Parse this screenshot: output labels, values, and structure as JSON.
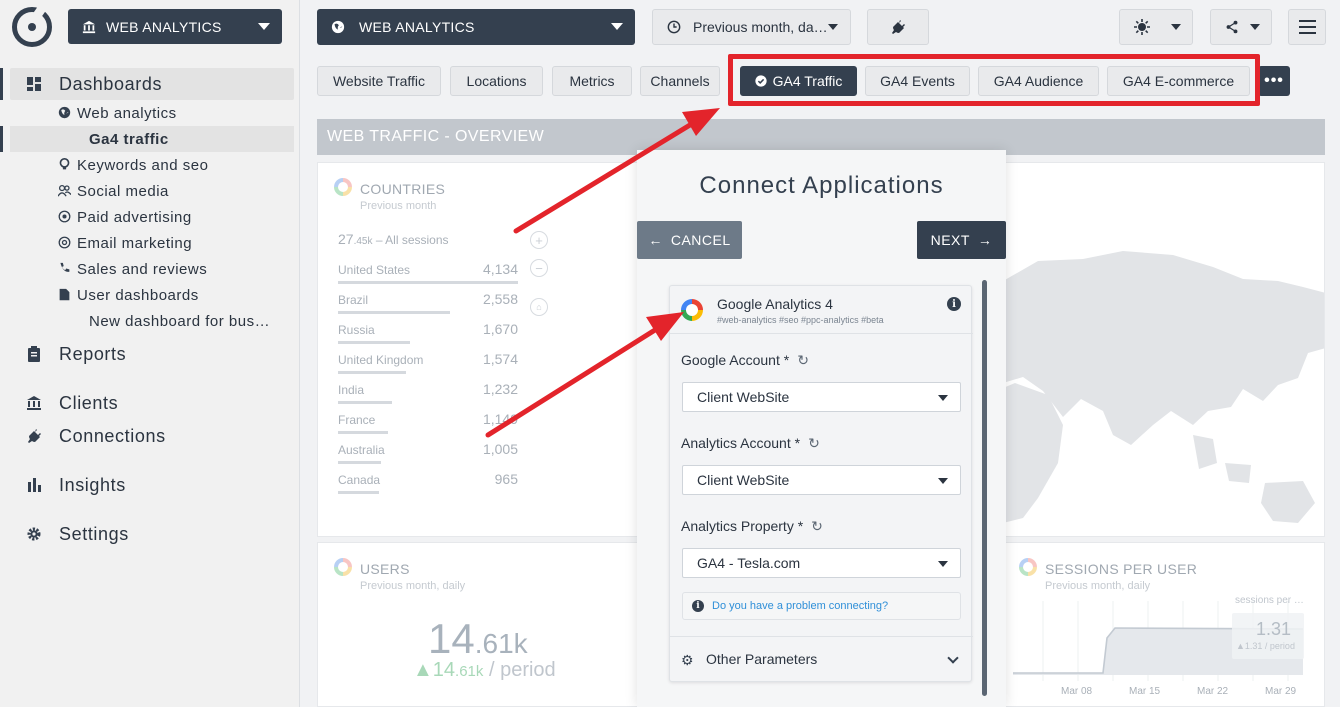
{
  "sidebar": {
    "workspace": "WEB ANALYTICS",
    "nav": {
      "dashboards": "Dashboards",
      "web_analytics": "Web analytics",
      "ga4_traffic": "Ga4 traffic",
      "keywords": "Keywords and seo",
      "social": "Social media",
      "paid": "Paid advertising",
      "email": "Email marketing",
      "sales": "Sales and reviews",
      "user_dashboards": "User dashboards",
      "new_dashboard": "New dashboard for bus…",
      "reports": "Reports",
      "clients": "Clients",
      "connections": "Connections",
      "insights": "Insights",
      "settings": "Settings"
    }
  },
  "topbar": {
    "project": "WEB ANALYTICS",
    "date_range": "Previous month, da…"
  },
  "tabs": [
    "Website Traffic",
    "Locations",
    "Metrics",
    "Channels",
    "GA4 Traffic",
    "GA4 Events",
    "GA4 Audience",
    "GA4 E-commerce"
  ],
  "tab_more": "•••",
  "dashboard": {
    "section_title": "WEB TRAFFIC - OVERVIEW",
    "countries": {
      "title": "COUNTRIES",
      "subtitle": "Previous month",
      "total_num": "27",
      "total_small": ".45k",
      "total_label": " – All sessions",
      "rows": [
        {
          "name": "United States",
          "value": "4,134",
          "share": 1.0
        },
        {
          "name": "Brazil",
          "value": "2,558",
          "share": 0.62
        },
        {
          "name": "Russia",
          "value": "1,670",
          "share": 0.4
        },
        {
          "name": "United Kingdom",
          "value": "1,574",
          "share": 0.38
        },
        {
          "name": "India",
          "value": "1,232",
          "share": 0.3
        },
        {
          "name": "France",
          "value": "1,149",
          "share": 0.28
        },
        {
          "name": "Australia",
          "value": "1,005",
          "share": 0.24
        },
        {
          "name": "Canada",
          "value": "965",
          "share": 0.23
        }
      ]
    },
    "users": {
      "title": "USERS",
      "subtitle": "Previous month, daily",
      "big_int": "14",
      "big_dec": ".61k",
      "delta_int": "▲14",
      "delta_dec": ".61k",
      "delta_suffix": " / period"
    },
    "sessions_per_user": {
      "title": "SESSIONS PER USER",
      "subtitle": "Previous month, daily",
      "legend": "sessions per …",
      "value": "1.31",
      "value_delta": "▲1.31 / period",
      "x_ticks": [
        "Mar 08",
        "Mar 15",
        "Mar 22",
        "Mar 29"
      ]
    }
  },
  "modal": {
    "title": "Connect Applications",
    "cancel": "CANCEL",
    "next": "NEXT",
    "app_name": "Google Analytics 4",
    "app_tags": "#web-analytics #seo #ppc-analytics #beta",
    "fields": [
      {
        "label": "Google Account *",
        "value": "Client WebSite"
      },
      {
        "label": "Analytics Account *",
        "value": "Client WebSite"
      },
      {
        "label": "Analytics Property *",
        "value": "GA4 - Tesla.com"
      }
    ],
    "help_link": "Do you have a problem connecting?",
    "other_params": "Other Parameters"
  }
}
